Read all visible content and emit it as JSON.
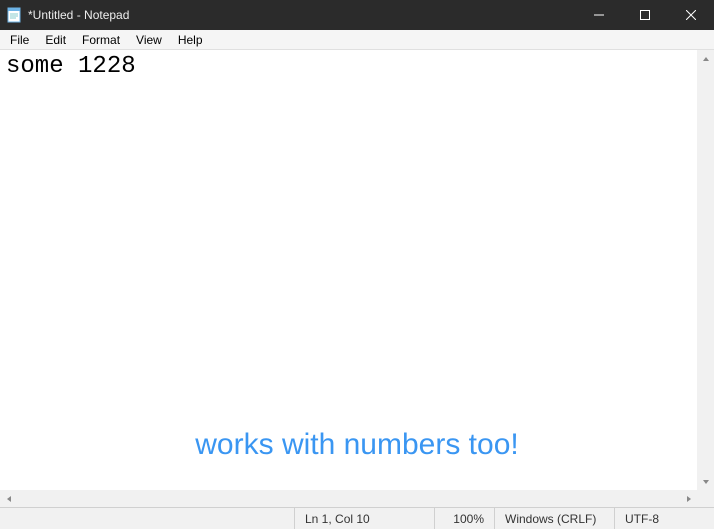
{
  "window": {
    "title": "*Untitled - Notepad"
  },
  "menu": {
    "file": "File",
    "edit": "Edit",
    "format": "Format",
    "view": "View",
    "help": "Help"
  },
  "editor": {
    "content": "some 1228"
  },
  "status": {
    "caret": "Ln 1, Col 10",
    "zoom": "100%",
    "line_ending": "Windows (CRLF)",
    "encoding": "UTF-8"
  },
  "annotation": {
    "text": "works with numbers too!"
  }
}
